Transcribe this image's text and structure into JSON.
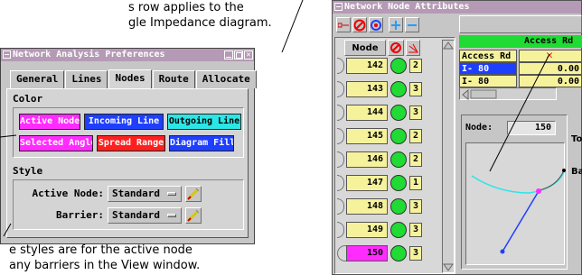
{
  "captions": {
    "top_line1": "s row applies to the",
    "top_line2": "gle Impedance diagram.",
    "bottom_line1": "e styles are for the active node",
    "bottom_line2": "any barriers in the View window."
  },
  "attributes_window": {
    "title": "Network Node Attributes",
    "grid_header": {
      "node_col": "Node"
    },
    "nodes": [
      {
        "id": "142",
        "count": "2"
      },
      {
        "id": "143",
        "count": "3"
      },
      {
        "id": "144",
        "count": "3"
      },
      {
        "id": "145",
        "count": "2"
      },
      {
        "id": "146",
        "count": "2"
      },
      {
        "id": "147",
        "count": "1"
      },
      {
        "id": "148",
        "count": "3"
      },
      {
        "id": "149",
        "count": "3"
      },
      {
        "id": "150",
        "count": "3"
      }
    ],
    "table": {
      "header": "Access Rd",
      "rows": [
        {
          "name": "Access Rd",
          "value": "✕"
        },
        {
          "name": "I- 80",
          "value": "0.00"
        },
        {
          "name": "I- 80",
          "value": "0.00"
        }
      ]
    },
    "node_label": "Node:",
    "node_value": "150",
    "side_label_1": "To",
    "side_label_2": "Ba"
  },
  "preferences_window": {
    "title": "Network Analysis Preferences",
    "close_glyph": "✕",
    "tabs": [
      "General",
      "Lines",
      "Nodes",
      "Route",
      "Allocate"
    ],
    "active_tab": "Nodes",
    "color_section": "Color",
    "color_buttons": [
      {
        "label": "Active Node",
        "bg": "#ff2bff",
        "fg": "#ffffff"
      },
      {
        "label": "Incoming Line",
        "bg": "#1f3fff",
        "fg": "#ffffff"
      },
      {
        "label": "Outgoing Line",
        "bg": "#2ce6e6",
        "fg": "#000000"
      },
      {
        "label": "Selected Angle",
        "bg": "#ff2bff",
        "fg": "#ffffff"
      },
      {
        "label": "Spread Range",
        "bg": "#ff1f1f",
        "fg": "#ffffff"
      },
      {
        "label": "Diagram Fill",
        "bg": "#1f3fff",
        "fg": "#ffffff"
      }
    ],
    "style_section": "Style",
    "style_rows": [
      {
        "label": "Active Node:",
        "value": "Standard"
      },
      {
        "label": "Barrier:",
        "value": "Standard"
      }
    ]
  },
  "colors": {
    "titlebar": "#b59ab5",
    "field_yellow": "#f6f29c",
    "status_green": "#1fdb33",
    "highlight_blue": "#1f3fff",
    "outgoing_cyan": "#2ce6e6",
    "error_red": "#ff1f1f"
  }
}
